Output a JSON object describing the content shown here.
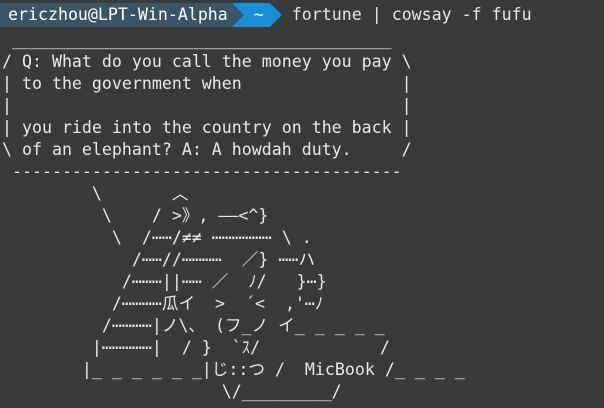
{
  "prompt": {
    "user_host": "ericzhou@LPT-Win-Alpha",
    "path": "~",
    "command": "fortune | cowsay -f fufu"
  },
  "output_lines": [
    " ______________________________________",
    "/ Q: What do you call the money you pay \\",
    "| to the government when                |",
    "|                                       |",
    "| you ride into the country on the back |",
    "\\ of an elephant? A: A howdah duty.     /",
    " ---------------------------------------",
    "         \\       ︿",
    "          \\    / >》, ——<^}",
    "           \\  /⋯⋯/≠≠ ⋯⋯⋯⋯⋯⋯ \\ .",
    "             /⋯⋯//⋯⋯⋯⋯  ／} ⋯⋯ハ",
    "            /⋯⋯⋯||⋯⋯ ／  ﾉ/   }⋯}",
    "           /⋯⋯⋯⋯瓜イ  >  ´<  ,'⋯ﾉ",
    "          /⋯⋯⋯⋯|ノ\\、 (フ_ノ イ_ _ _ _ _",
    "         |⋯⋯⋯⋯⋯|  / }  `ｽ/            /",
    "        |_ _ _ _ _ _|じ::つ /  MicBook /_ _ _ _",
    "                      \\/_________/"
  ],
  "colors": {
    "background": "#3a3a3a",
    "user_segment": "#3c5566",
    "path_segment": "#1a8fd8",
    "text": "#e6e6e6"
  }
}
